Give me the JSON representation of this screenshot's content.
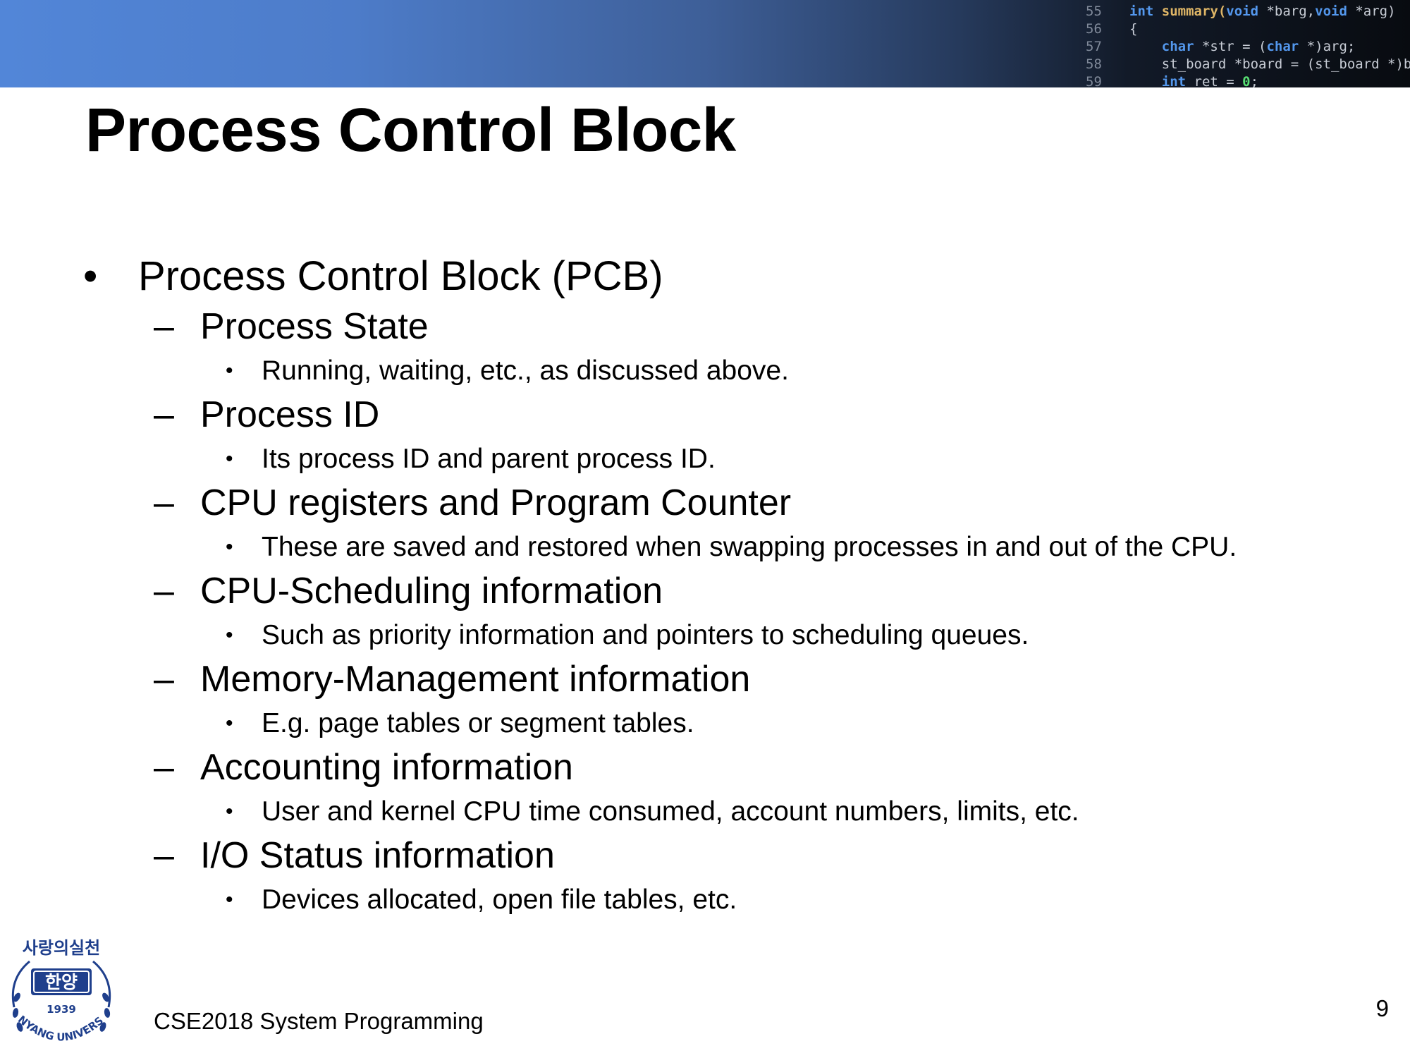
{
  "slide": {
    "title": "Process Control Block",
    "footer": "CSE2018 System Programming",
    "page_number": "9"
  },
  "banner": {
    "code_lines": [
      {
        "num": "55",
        "code": [
          {
            "t": "int ",
            "c": "kw"
          },
          {
            "t": "summary(",
            "c": "fn"
          },
          {
            "t": "void ",
            "c": "kw"
          },
          {
            "t": "*barg,",
            "c": ""
          },
          {
            "t": "void ",
            "c": "kw"
          },
          {
            "t": "*arg)",
            "c": ""
          }
        ]
      },
      {
        "num": "56",
        "code": [
          {
            "t": "{",
            "c": ""
          }
        ]
      },
      {
        "num": "57",
        "code": [
          {
            "t": "    ",
            "c": ""
          },
          {
            "t": "char ",
            "c": "kw"
          },
          {
            "t": "*str = (",
            "c": ""
          },
          {
            "t": "char ",
            "c": "kw"
          },
          {
            "t": "*)arg;",
            "c": ""
          }
        ]
      },
      {
        "num": "58",
        "code": [
          {
            "t": "    st_board *board = (st_board *)bar",
            "c": ""
          }
        ]
      },
      {
        "num": "59",
        "code": [
          {
            "t": "    ",
            "c": ""
          },
          {
            "t": "int ",
            "c": "kw"
          },
          {
            "t": "ret = ",
            "c": ""
          },
          {
            "t": "0",
            "c": "num"
          },
          {
            "t": ";",
            "c": ""
          }
        ]
      }
    ]
  },
  "content": {
    "main_bullet": "Process Control Block (PCB)",
    "bullet_symbol": "•",
    "dash_symbol": "–",
    "sections": [
      {
        "heading": "Process State",
        "detail": "Running, waiting, etc., as discussed above."
      },
      {
        "heading": "Process ID",
        "detail": "Its process ID and parent process ID."
      },
      {
        "heading": "CPU registers and Program Counter",
        "detail": "These are saved and restored when swapping processes in and out of the CPU."
      },
      {
        "heading": "CPU-Scheduling information",
        "detail": "Such as priority information and pointers to scheduling queues."
      },
      {
        "heading": "Memory-Management information",
        "detail": "E.g. page tables or segment tables."
      },
      {
        "heading": "Accounting information",
        "detail": "User and kernel CPU time consumed, account numbers, limits, etc."
      },
      {
        "heading": "I/O Status information",
        "detail": "Devices allocated, open file tables, etc."
      }
    ]
  },
  "logo": {
    "icon": "university-seal-icon",
    "top_text": "사랑의실천",
    "center_text": "한양",
    "year": "1939",
    "bottom_text": "HANYANG UNIVERSITY",
    "color": "#1f3f8c"
  }
}
